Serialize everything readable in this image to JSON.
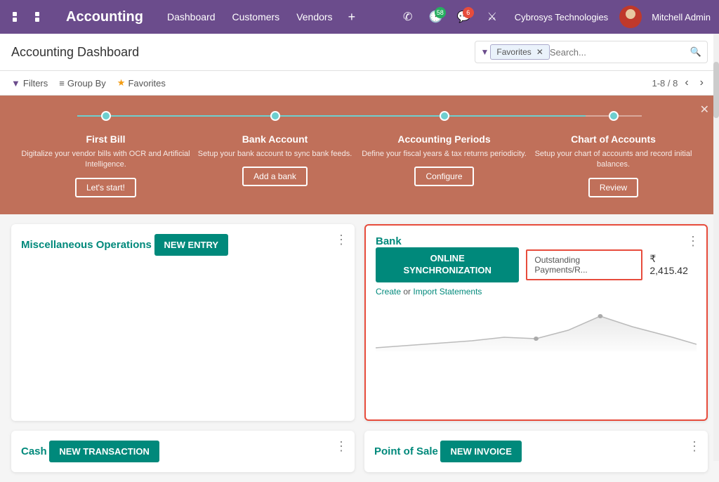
{
  "topnav": {
    "title": "Accounting",
    "menu": [
      "Dashboard",
      "Customers",
      "Vendors"
    ],
    "plus_label": "+",
    "badge_58": "58",
    "badge_6": "6",
    "company": "Cybrosys Technologies",
    "username": "Mitchell Admin"
  },
  "breadcrumb": {
    "title": "Accounting Dashboard",
    "search_tag": "Favorites",
    "search_placeholder": "Search..."
  },
  "filterbar": {
    "filters_label": "Filters",
    "groupby_label": "Group By",
    "favorites_label": "Favorites",
    "pagination": "1-8 / 8"
  },
  "onboarding": {
    "steps": [
      {
        "title": "First Bill",
        "desc": "Digitalize your vendor bills with OCR and Artificial Intelligence.",
        "btn": "Let's start!"
      },
      {
        "title": "Bank Account",
        "desc": "Setup your bank account to sync bank feeds.",
        "btn": "Add a bank"
      },
      {
        "title": "Accounting Periods",
        "desc": "Define your fiscal years & tax returns periodicity.",
        "btn": "Configure"
      },
      {
        "title": "Chart of Accounts",
        "desc": "Setup your chart of accounts and record initial balances.",
        "btn": "Review"
      }
    ]
  },
  "cards": {
    "misc": {
      "title": "Miscellaneous Operations",
      "btn_label": "NEW ENTRY"
    },
    "bank": {
      "title": "Bank",
      "sync_btn": "ONLINE SYNCHRONIZATION",
      "outstanding_label": "Outstanding Payments/R...",
      "amount": "₹ 2,415.42",
      "import_text_create": "Create",
      "import_text_or": " or ",
      "import_text_import": "Import Statements"
    },
    "cash": {
      "title": "Cash",
      "btn_label": "NEW TRANSACTION"
    },
    "pos": {
      "title": "Point of Sale",
      "btn_label": "NEW INVOICE"
    }
  }
}
